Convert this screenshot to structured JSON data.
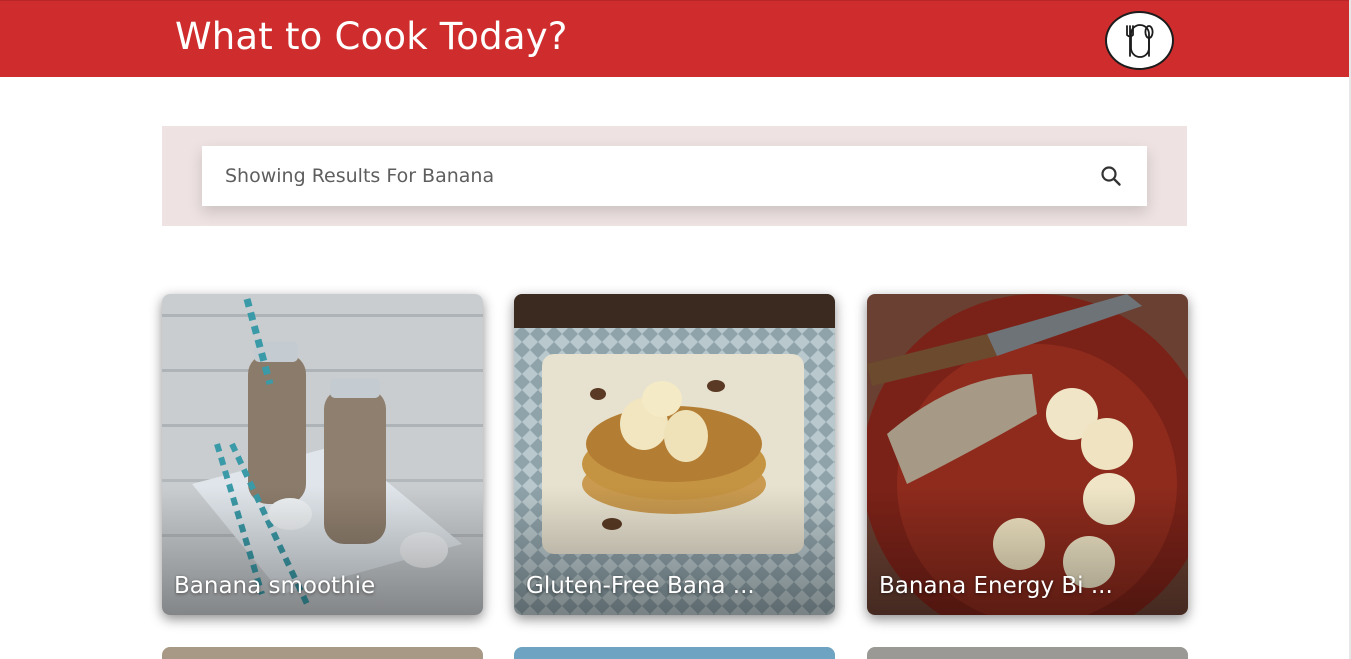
{
  "header": {
    "title": "What to Cook Today?",
    "logo_icon": "fork-spoon-icon",
    "brand_color": "#cf2c2d"
  },
  "search": {
    "placeholder": "Showing Results For Banana",
    "value": "",
    "button_icon": "search-icon"
  },
  "recipes": [
    {
      "title": "Banana smoothie"
    },
    {
      "title": "Gluten-Free Bana ..."
    },
    {
      "title": "Banana Energy Bi ..."
    }
  ]
}
